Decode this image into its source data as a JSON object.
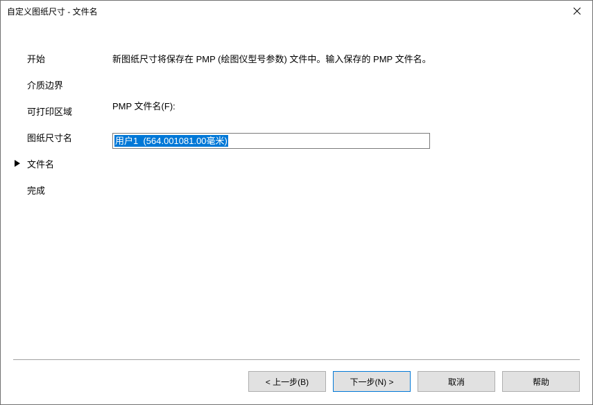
{
  "titlebar": {
    "title": "自定义图纸尺寸 - 文件名"
  },
  "sidebar": {
    "items": [
      {
        "label": "开始"
      },
      {
        "label": "介质边界"
      },
      {
        "label": "可打印区域"
      },
      {
        "label": "图纸尺寸名"
      },
      {
        "label": "文件名"
      },
      {
        "label": "完成"
      }
    ],
    "currentIndex": 4
  },
  "main": {
    "description": "新图纸尺寸将保存在 PMP (绘图仪型号参数) 文件中。输入保存的 PMP 文件名。",
    "field_label": "PMP 文件名(F):",
    "field_value": "用户1  (564.001081.00毫米)"
  },
  "buttons": {
    "back": "< 上一步(B)",
    "next": "下一步(N) >",
    "cancel": "取消",
    "help": "帮助"
  }
}
